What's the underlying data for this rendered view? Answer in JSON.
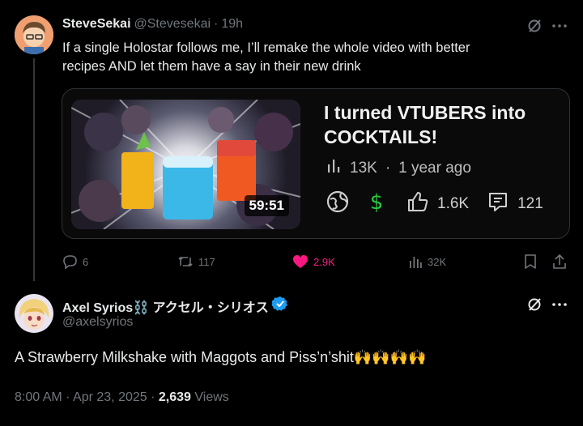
{
  "tweet1": {
    "display_name": "SteveSekai",
    "handle": "@Stevesekai",
    "separator": "·",
    "time": "19h",
    "text_line1": "If a single Holostar follows me, I’ll remake the whole video with better",
    "text_line2": "recipes AND let them have a say in their new drink",
    "card": {
      "title_line1": "I turned VTUBERS into",
      "title_line2": "COCKTAILS!",
      "views": "13K",
      "dot": "·",
      "age": "1 year ago",
      "duration": "59:51",
      "likes": "1.6K",
      "comments": "121"
    },
    "actions": {
      "replies": "6",
      "retweets": "117",
      "likes": "2.9K",
      "views": "32K"
    }
  },
  "tweet2": {
    "display_name": "Axel Syrios⛓️ アクセル・シリオス",
    "handle": "@axelsyrios",
    "text": "A Strawberry Milkshake with Maggots and Piss’n’shit🙌🙌🙌🙌",
    "time": "8:00 AM · Apr 23, 2025 · ",
    "views_count": "2,639",
    "views_label": " Views"
  },
  "colors": {
    "background": "#000000",
    "text": "#e7e9ea",
    "muted": "#71767b",
    "like_pink": "#f91880",
    "verified_blue": "#1d9bf0",
    "dollar_green": "#27c93f"
  }
}
